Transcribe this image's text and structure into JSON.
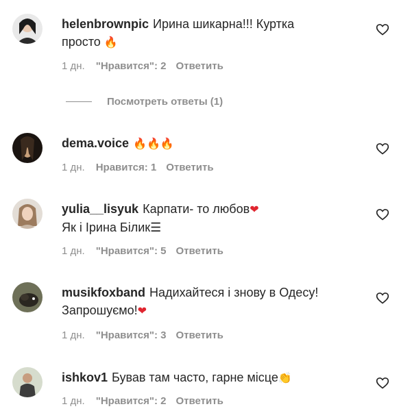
{
  "comments": [
    {
      "username": "helenbrownpic",
      "text_line1": "Ирина шикарна!!! Куртка",
      "text_line2": "просто",
      "emoji": "🔥",
      "time": "1 дн.",
      "likes": "\"Нравится\": 2",
      "reply": "Ответить",
      "avatar_color": "#2b2b2b"
    },
    {
      "username": "dema.voice",
      "text_line1": "",
      "emoji": "🔥🔥🔥",
      "time": "1 дн.",
      "likes": "Нравится: 1",
      "reply": "Ответить",
      "avatar_color": "#3a2a1e"
    },
    {
      "username": "yulia__lisyuk",
      "text_line1": "Карпати- то любов",
      "text_line2": "Як і Ірина Білик",
      "emoji": "❤",
      "flag": "☰",
      "time": "1 дн.",
      "likes": "\"Нравится\": 5",
      "reply": "Ответить",
      "avatar_color": "#b9a08a"
    },
    {
      "username": "musikfoxband",
      "text_line1": "Надихайтеся і знову в Одесу!",
      "text_line2": "Запрошуємо!",
      "emoji": "❤",
      "time": "1 дн.",
      "likes": "\"Нравится\": 3",
      "reply": "Ответить",
      "avatar_color": "#4a4a40"
    },
    {
      "username": "ishkov1",
      "text_line1": "Бував там часто, гарне місце",
      "emoji": "👏",
      "time": "1 дн.",
      "likes": "\"Нравится\": 2",
      "reply": "Ответить",
      "avatar_color": "#7a8a6a"
    }
  ],
  "view_replies": "Посмотреть ответы (1)",
  "colors": {
    "text": "#262626",
    "secondary": "#8e8e8e",
    "background": "#ffffff"
  }
}
